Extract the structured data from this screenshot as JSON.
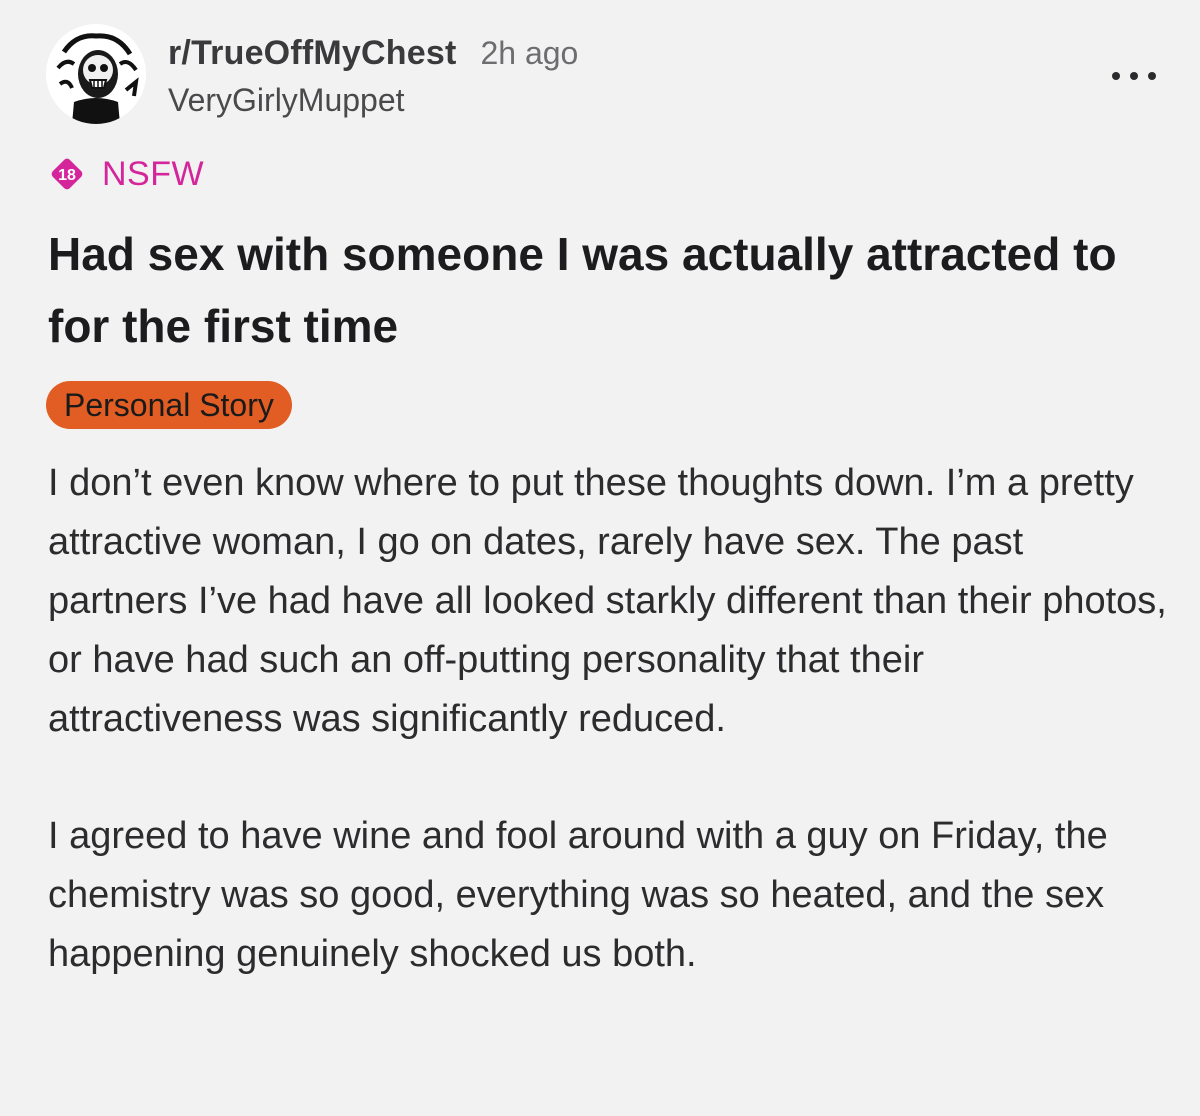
{
  "post": {
    "subreddit": "r/TrueOffMyChest",
    "time_ago": "2h ago",
    "username": "VeryGirlyMuppet",
    "nsfw_badge_number": "18",
    "nsfw_label": "NSFW",
    "title": "Had sex with someone I was actually attracted to for the first time",
    "flair": "Personal Story",
    "body": [
      "I don’t even know where to put these thoughts down. I’m a pretty attractive woman, I go on dates, rarely have sex. The past partners I’ve had have all looked starkly different than their photos, or have had such an off-putting personality that their attractiveness was significantly reduced.",
      "I agreed to have wine and fool around with a guy on Friday, the chemistry was so good, everything was so heated, and the sex happening genuinely shocked us both."
    ]
  },
  "colors": {
    "background": "#f2f2f2",
    "nsfw_accent": "#d4259a",
    "flair_background": "#e15d24"
  },
  "icons": {
    "avatar": "subreddit-avatar-skull-illustration",
    "more": "more-horizontal-icon",
    "nsfw": "nsfw-18-diamond-icon"
  }
}
